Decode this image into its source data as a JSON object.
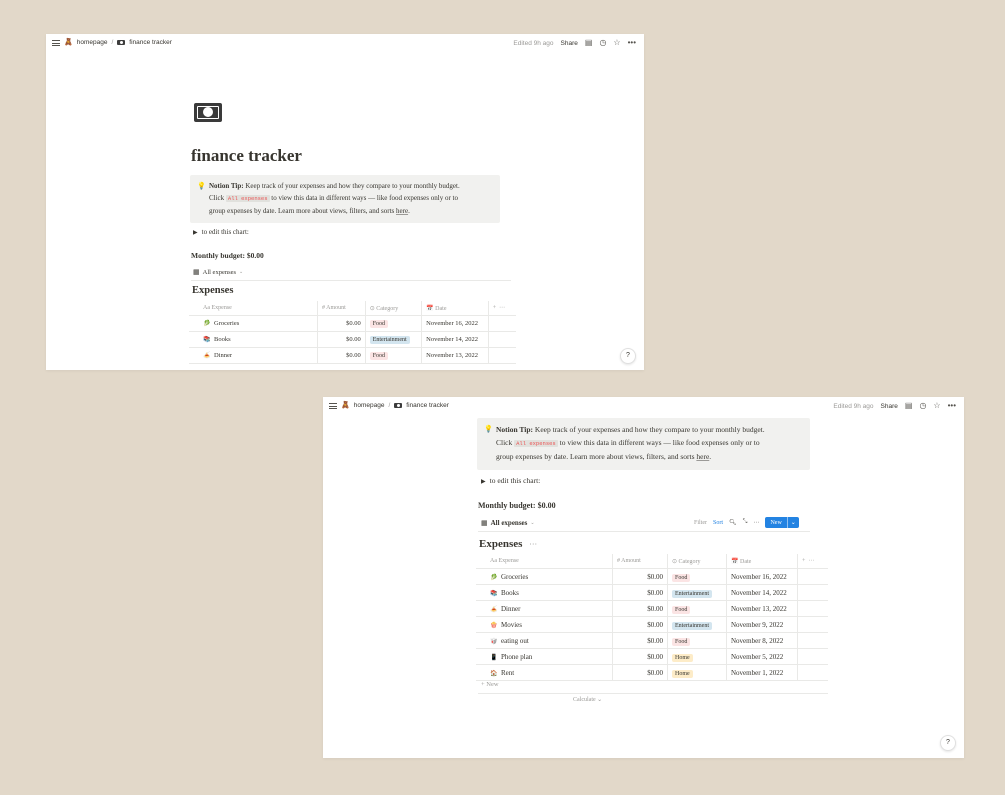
{
  "breadcrumb": {
    "home": "homepage",
    "separator": "/",
    "page": "finance tracker"
  },
  "topbar": {
    "edited": "Edited 9h ago",
    "share": "Share"
  },
  "page": {
    "title": "finance tracker"
  },
  "callout": {
    "bold": "Notion Tip:",
    "text1": " Keep track of your expenses and how they compare to your monthly budget.",
    "text2": "Click ",
    "code": "All expenses",
    "text3": " to view this data in different ways — like food expenses only or to",
    "text4": "group expenses by date. Learn more about views, filters, and sorts ",
    "link": "here",
    "end": "."
  },
  "toggle": {
    "label": "to edit this chart:"
  },
  "budget": {
    "label": "Monthly budget: $0.00"
  },
  "view": {
    "label": "All expenses",
    "chevron": "⌄"
  },
  "toolbar": {
    "filter": "Filter",
    "sort": "Sort",
    "new": "New"
  },
  "database": {
    "title": "Expenses",
    "more": "···",
    "columns": {
      "expense": "Aa Expense",
      "amount": "# Amount",
      "category": "⊙ Category",
      "date": "Date"
    },
    "rows": [
      {
        "emoji": "🥬",
        "name": "Groceries",
        "amount": "$0.00",
        "category": "Food",
        "date": "November 16, 2022"
      },
      {
        "emoji": "📚",
        "name": "Books",
        "amount": "$0.00",
        "category": "Entertainment",
        "date": "November 14, 2022"
      },
      {
        "emoji": "🍝",
        "name": "Dinner",
        "amount": "$0.00",
        "category": "Food",
        "date": "November 13, 2022"
      },
      {
        "emoji": "🍿",
        "name": "Movies",
        "amount": "$0.00",
        "category": "Entertainment",
        "date": "November 9, 2022"
      },
      {
        "emoji": "🥡",
        "name": "eating out",
        "amount": "$0.00",
        "category": "Food",
        "date": "November 8, 2022"
      },
      {
        "emoji": "📱",
        "name": "Phone plan",
        "amount": "$0.00",
        "category": "Home",
        "date": "November 5, 2022"
      },
      {
        "emoji": "🏠",
        "name": "Rent",
        "amount": "$0.00",
        "category": "Home",
        "date": "November 1, 2022"
      }
    ],
    "new_row": "+ New",
    "calculate": "Calculate ⌄"
  },
  "help": "?",
  "colors": {
    "background": "#e2d8c9",
    "food_tag": "#fbe4e4",
    "entertainment_tag": "#d3e5ef",
    "home_tag": "#fdecc8",
    "accent": "#2383e2"
  }
}
